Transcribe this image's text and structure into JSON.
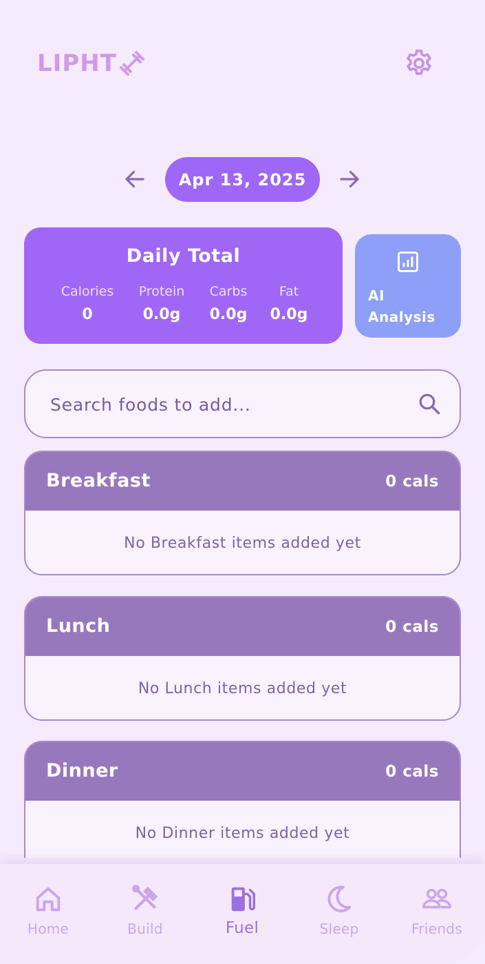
{
  "header": {
    "logo_text": "LIPHT",
    "logo_icon": "dumbbell-icon",
    "settings_icon": "gear-icon"
  },
  "date_nav": {
    "date": "Apr 13, 2025",
    "prev_icon": "arrow-left-icon",
    "next_icon": "arrow-right-icon"
  },
  "daily_total": {
    "title": "Daily Total",
    "macros": [
      {
        "label": "Calories",
        "value": "0"
      },
      {
        "label": "Protein",
        "value": "0.0g"
      },
      {
        "label": "Carbs",
        "value": "0.0g"
      },
      {
        "label": "Fat",
        "value": "0.0g"
      }
    ]
  },
  "ai_analysis": {
    "label_line1": "AI",
    "label_line2": "Analysis",
    "icon": "bar-chart-icon"
  },
  "search": {
    "placeholder": "Search foods to add...",
    "icon": "search-icon"
  },
  "meals": [
    {
      "name": "Breakfast",
      "cals": "0 cals",
      "empty_text": "No Breakfast items added yet"
    },
    {
      "name": "Lunch",
      "cals": "0 cals",
      "empty_text": "No Lunch items added yet"
    },
    {
      "name": "Dinner",
      "cals": "0 cals",
      "empty_text": "No Dinner items added yet"
    }
  ],
  "bottom_nav": [
    {
      "label": "Home",
      "icon": "home-icon",
      "active": false
    },
    {
      "label": "Build",
      "icon": "tools-icon",
      "active": false
    },
    {
      "label": "Fuel",
      "icon": "fuel-pump-icon",
      "active": true
    },
    {
      "label": "Sleep",
      "icon": "moon-icon",
      "active": false
    },
    {
      "label": "Friends",
      "icon": "people-icon",
      "active": false
    }
  ],
  "colors": {
    "background": "#f6ebfc",
    "primary": "#a066f5",
    "ai_card": "#8d9ff7",
    "meal_header": "#9778bd",
    "logo": "#d09ae8"
  }
}
